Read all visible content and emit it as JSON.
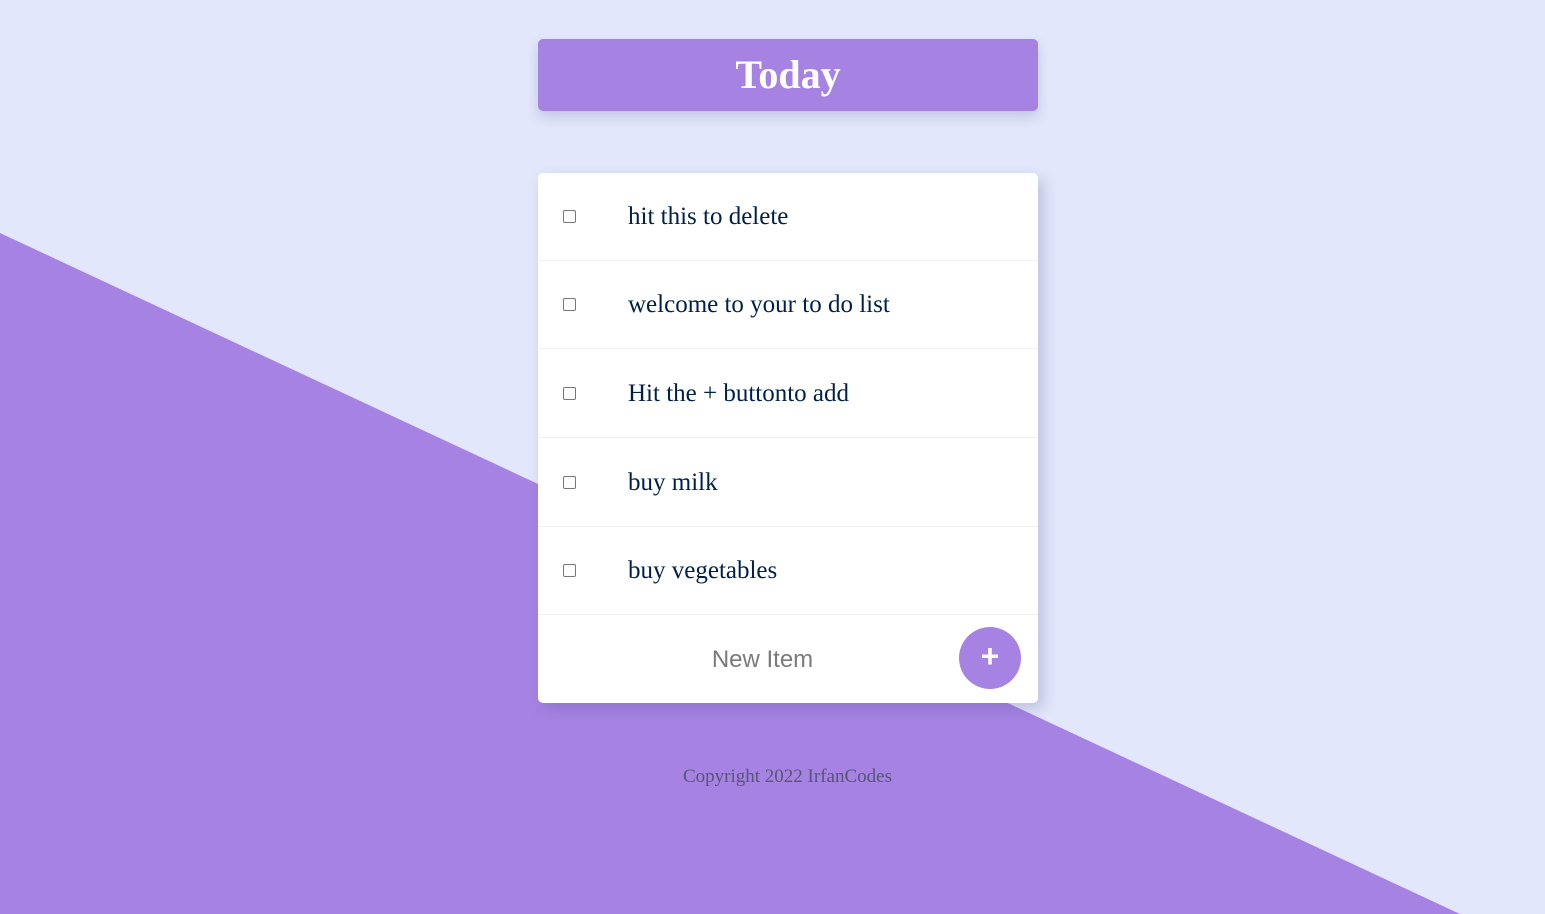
{
  "colors": {
    "background": "#E3E7FB",
    "accent": "#A683E3",
    "item_text": "#00204A"
  },
  "header": {
    "title": "Today"
  },
  "todo": {
    "items": [
      {
        "label": "hit this to delete",
        "checked": false
      },
      {
        "label": "welcome to your to do list",
        "checked": false
      },
      {
        "label": "Hit the + buttonto add",
        "checked": false
      },
      {
        "label": "buy milk",
        "checked": false
      },
      {
        "label": "buy vegetables",
        "checked": false
      }
    ],
    "new_item": {
      "placeholder": "New Item",
      "value": "",
      "add_button_label": "+",
      "add_button_icon": "plus-icon"
    }
  },
  "footer": {
    "text": "Copyright 2022 IrfanCodes"
  }
}
